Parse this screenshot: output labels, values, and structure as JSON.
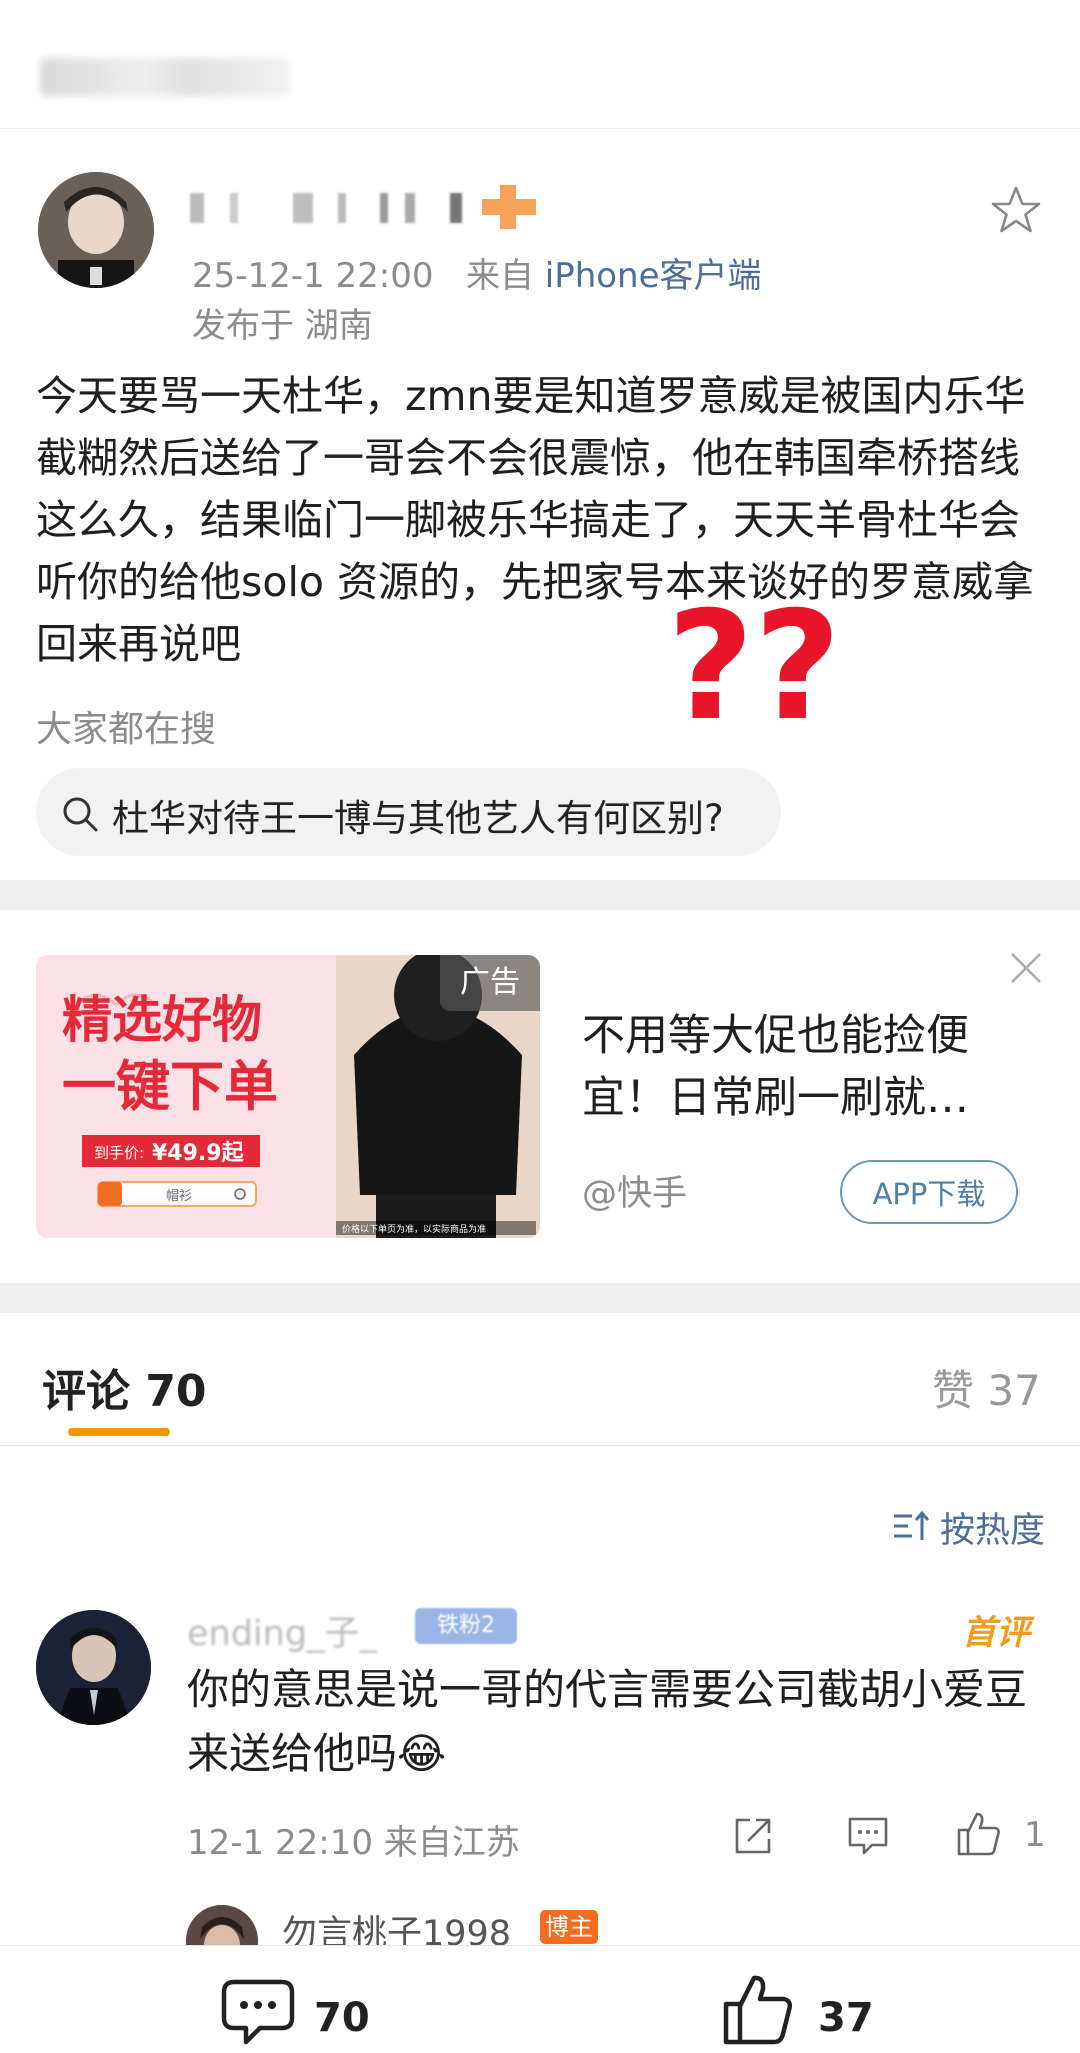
{
  "post": {
    "time": "25-12-1 22:00",
    "source_prefix": "来自",
    "source": "iPhone客户端",
    "location": "发布于 湖南",
    "text": "今天要骂一天杜华，zmn要是知道罗意威是被国内乐华截糊然后送给了一哥会不会很震惊，他在韩国牵桥搭线这么久，结果临门一脚被乐华搞走了，天天羊骨杜华会听你的给他solo 资源的，先把家号本来谈好的罗意威拿回来再说吧",
    "favorite_icon": "star-outline-icon",
    "annotation_glyphs": "??"
  },
  "search": {
    "title": "大家都在搜",
    "query": "杜华对待王一博与其他艺人有何区别?"
  },
  "ad": {
    "tag": "广告",
    "title": "不用等大促也能捡便宜！日常刷一刷就…",
    "brand": "@快手",
    "download_label": "APP下载",
    "image": {
      "headline_1": "精选好物",
      "headline_2": "一键下单",
      "price_label": "到手价:",
      "price": "¥49.9起",
      "search_term": "帽衫",
      "disclaimer": "价格以下单页为准，以实际商品为准"
    }
  },
  "comments_section": {
    "tab_comments": "评论 70",
    "tab_likes": "赞 37",
    "sort_label": "按热度",
    "accent_color": "#f39800"
  },
  "comments": [
    {
      "name": "ending_子_",
      "badge": "铁粉2",
      "top_label": "首评",
      "text": "你的意思是说一哥的代言需要公司截胡小爱豆来送给他吗😂",
      "meta": "12-1 22:10 来自江苏",
      "likes": "1"
    },
    {
      "name": "勿言桃子1998",
      "badge": "博主"
    }
  ],
  "bottom_bar": {
    "comment_count": "70",
    "like_count": "37"
  }
}
